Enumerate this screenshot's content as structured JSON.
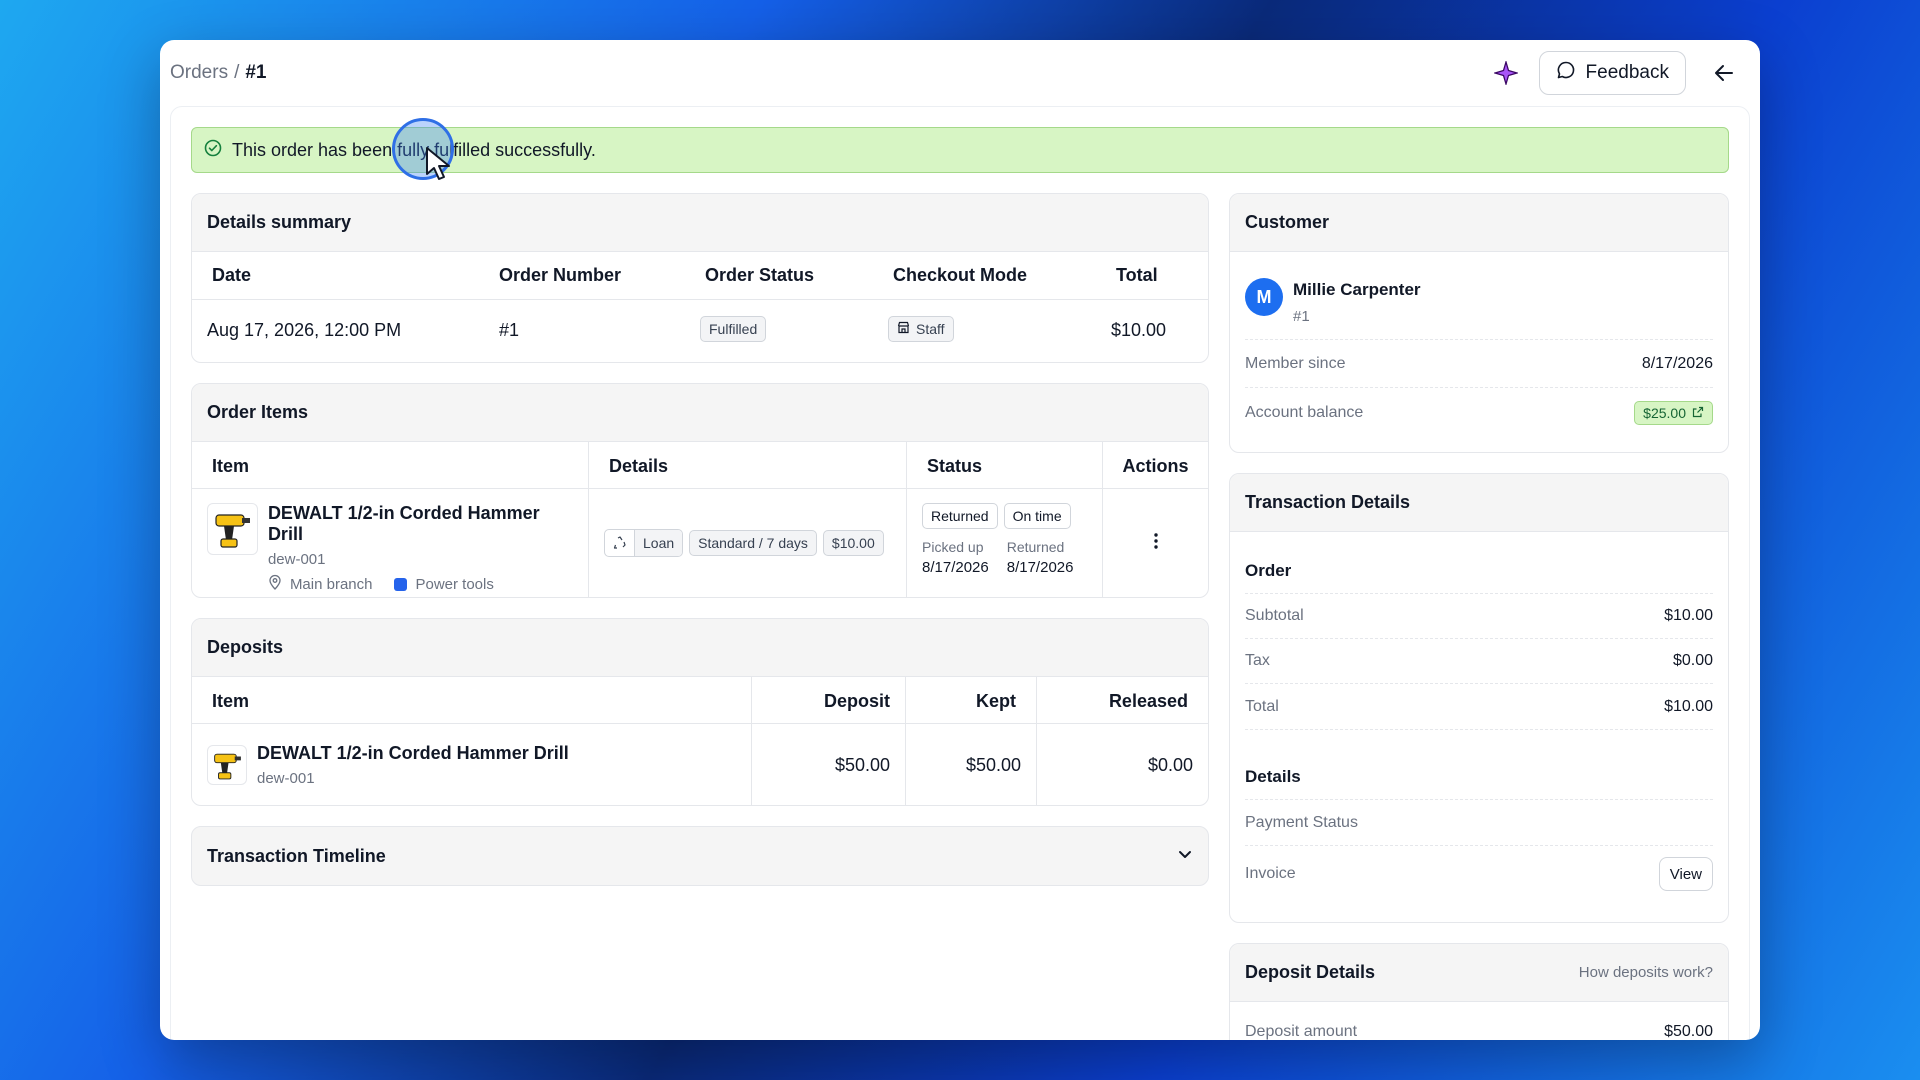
{
  "breadcrumb": {
    "parent": "Orders",
    "separator": "/",
    "current": "#1"
  },
  "topbar": {
    "feedback_label": "Feedback"
  },
  "alert": {
    "message": "This order has been fully fulfilled successfully."
  },
  "details_summary": {
    "title": "Details summary",
    "columns": [
      "Date",
      "Order Number",
      "Order Status",
      "Checkout Mode",
      "Total"
    ],
    "row": {
      "date": "Aug 17, 2026, 12:00 PM",
      "order_number": "#1",
      "status": "Fulfilled",
      "checkout_mode": "Staff",
      "total": "$10.00"
    }
  },
  "order_items": {
    "title": "Order Items",
    "columns": [
      "Item",
      "Details",
      "Status",
      "Actions"
    ],
    "item": {
      "name": "DEWALT 1/2-in Corded Hammer Drill",
      "sku": "dew-001",
      "location": "Main branch",
      "category": "Power tools",
      "category_color": "#2563eb",
      "type": "Loan",
      "period": "Standard / 7 days",
      "price": "$10.00",
      "status_badge": "Returned",
      "timing_badge": "On time",
      "picked_up_label": "Picked up",
      "picked_up_date": "8/17/2026",
      "returned_label": "Returned",
      "returned_date": "8/17/2026"
    }
  },
  "deposits": {
    "title": "Deposits",
    "columns": [
      "Item",
      "Deposit",
      "Kept",
      "Released"
    ],
    "row": {
      "name": "DEWALT 1/2-in Corded Hammer Drill",
      "sku": "dew-001",
      "deposit": "$50.00",
      "kept": "$50.00",
      "released": "$0.00"
    }
  },
  "timeline": {
    "title": "Transaction Timeline"
  },
  "customer": {
    "title": "Customer",
    "avatar_initial": "M",
    "avatar_color": "#1d6ef0",
    "name": "Millie Carpenter",
    "id": "#1",
    "member_since_label": "Member since",
    "member_since": "8/17/2026",
    "balance_label": "Account balance",
    "balance": "$25.00"
  },
  "transaction_details": {
    "title": "Transaction Details",
    "order_heading": "Order",
    "subtotal_label": "Subtotal",
    "subtotal": "$10.00",
    "tax_label": "Tax",
    "tax": "$0.00",
    "total_label": "Total",
    "total": "$10.00",
    "details_heading": "Details",
    "payment_status_label": "Payment Status",
    "invoice_label": "Invoice",
    "invoice_button": "View"
  },
  "deposit_details": {
    "title": "Deposit Details",
    "help_link": "How deposits work?",
    "amount_label": "Deposit amount",
    "amount": "$50.00"
  }
}
